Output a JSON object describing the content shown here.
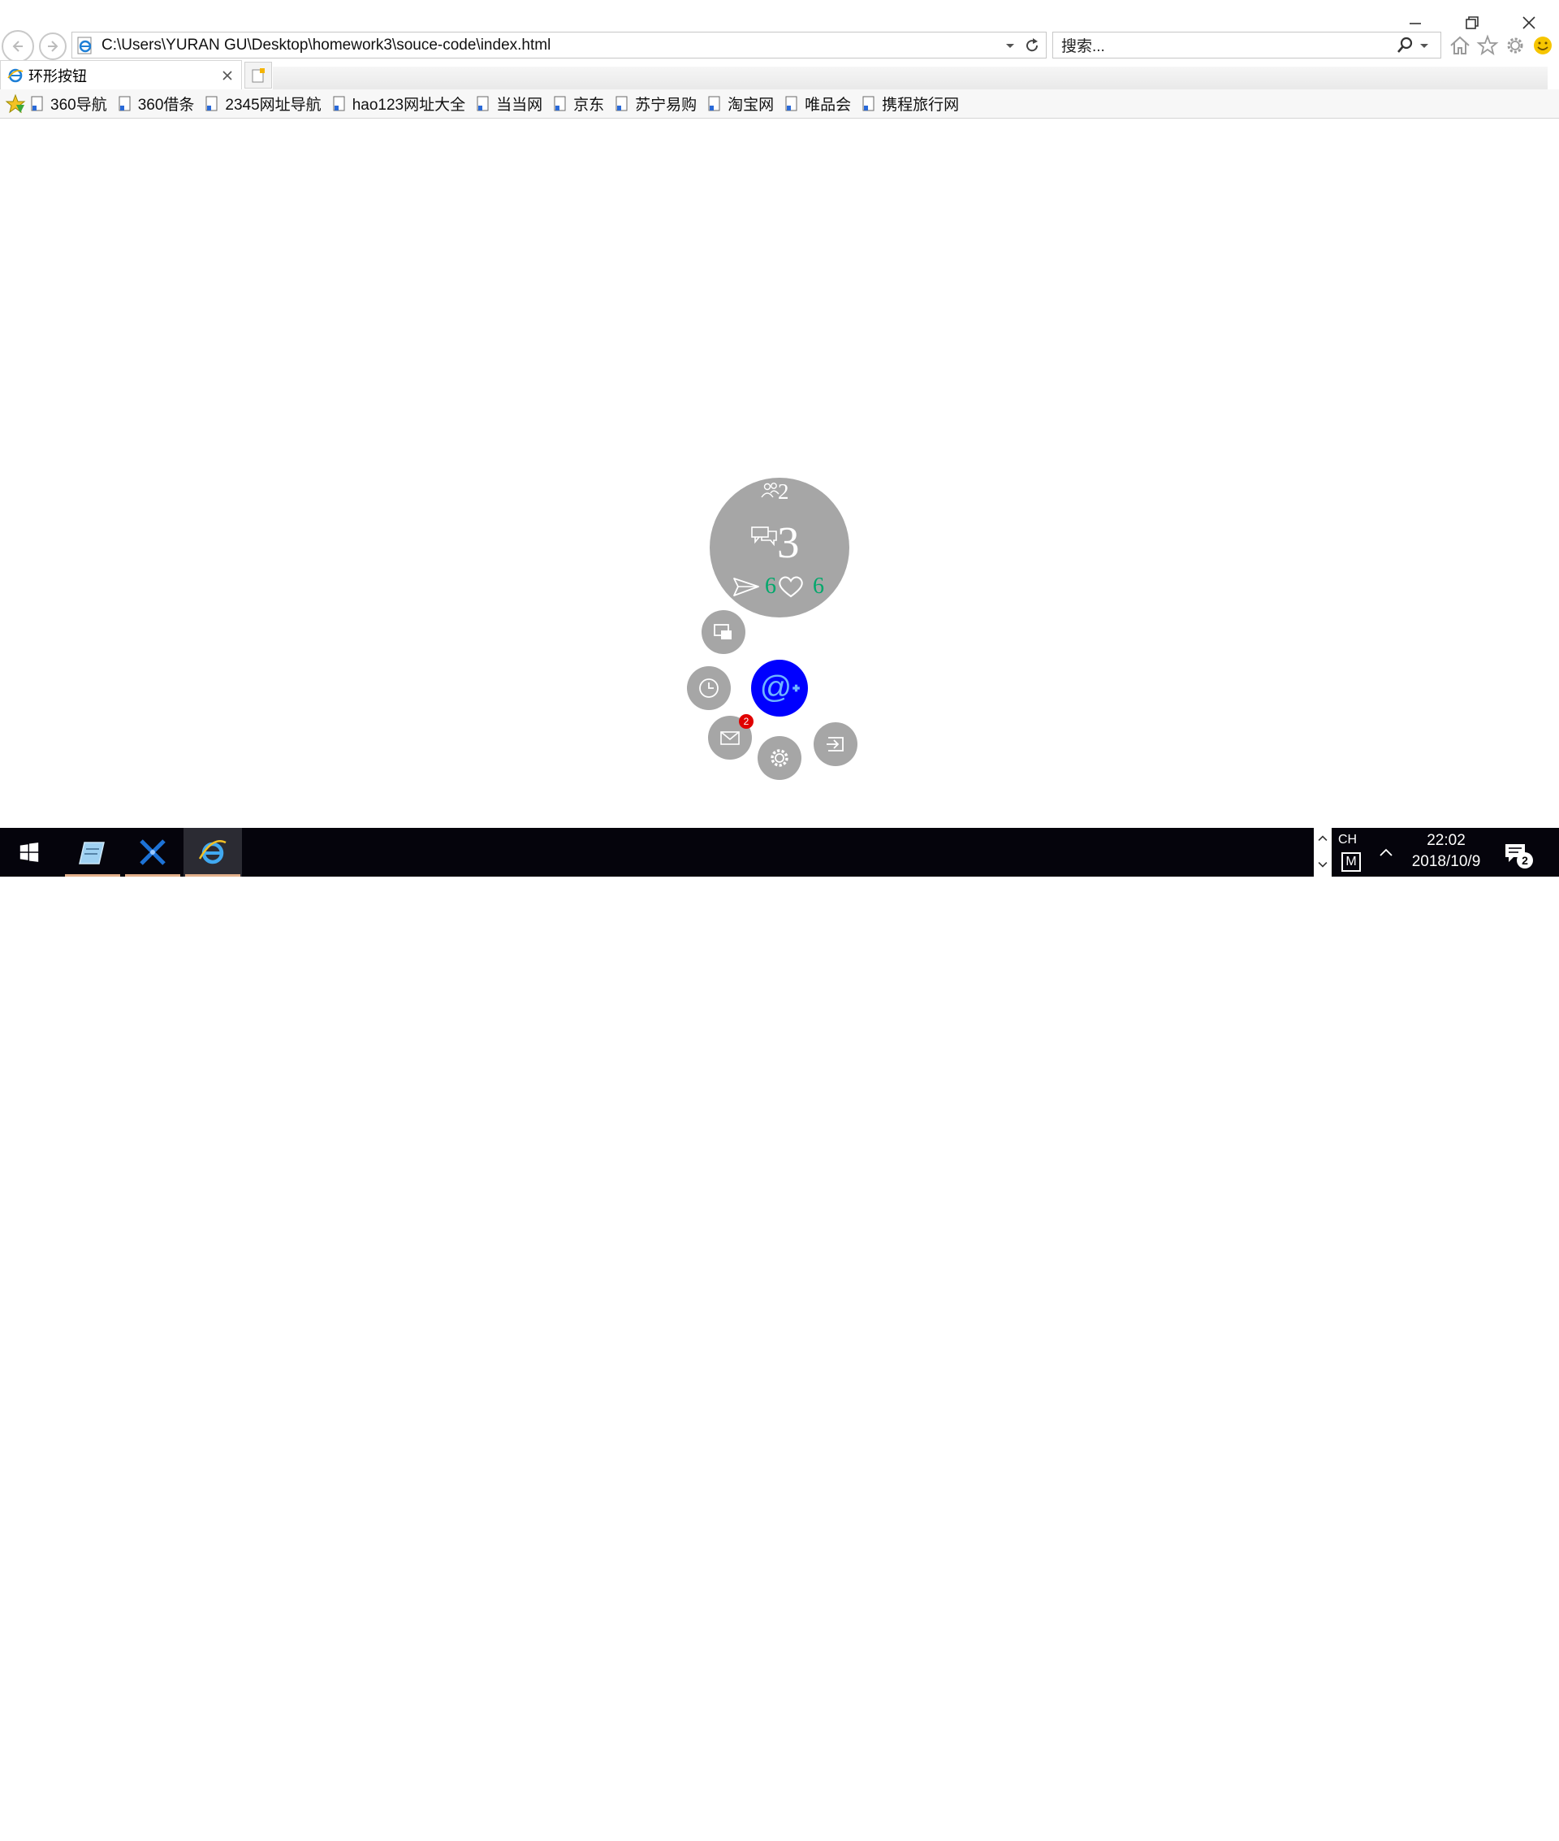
{
  "window": {
    "controls": [
      "minimize-icon",
      "restore-icon",
      "close-icon"
    ]
  },
  "address": {
    "url": "C:\\Users\\YURAN GU\\Desktop\\homework3\\souce-code\\index.html"
  },
  "search": {
    "placeholder": "搜索..."
  },
  "tab": {
    "title": "环形按钮"
  },
  "favorites": {
    "items": [
      {
        "label": "360导航"
      },
      {
        "label": "360借条"
      },
      {
        "label": "2345网址导航"
      },
      {
        "label": "hao123网址大全"
      },
      {
        "label": "当当网"
      },
      {
        "label": "京东"
      },
      {
        "label": "苏宁易购"
      },
      {
        "label": "淘宝网"
      },
      {
        "label": "唯品会"
      },
      {
        "label": "携程旅行网"
      }
    ]
  },
  "ring": {
    "stats": {
      "users": "2",
      "chats": "3",
      "sends": "6",
      "likes": "6"
    },
    "mail_badge": "2",
    "colors": {
      "circle": "#a6a6a6",
      "center": "#0000ff",
      "stat_green": "#00a86b",
      "badge": "#e00000"
    }
  },
  "taskbar": {
    "lang": "CH",
    "ime": "M",
    "time": "22:02",
    "date": "2018/10/9",
    "notifications": "2"
  }
}
